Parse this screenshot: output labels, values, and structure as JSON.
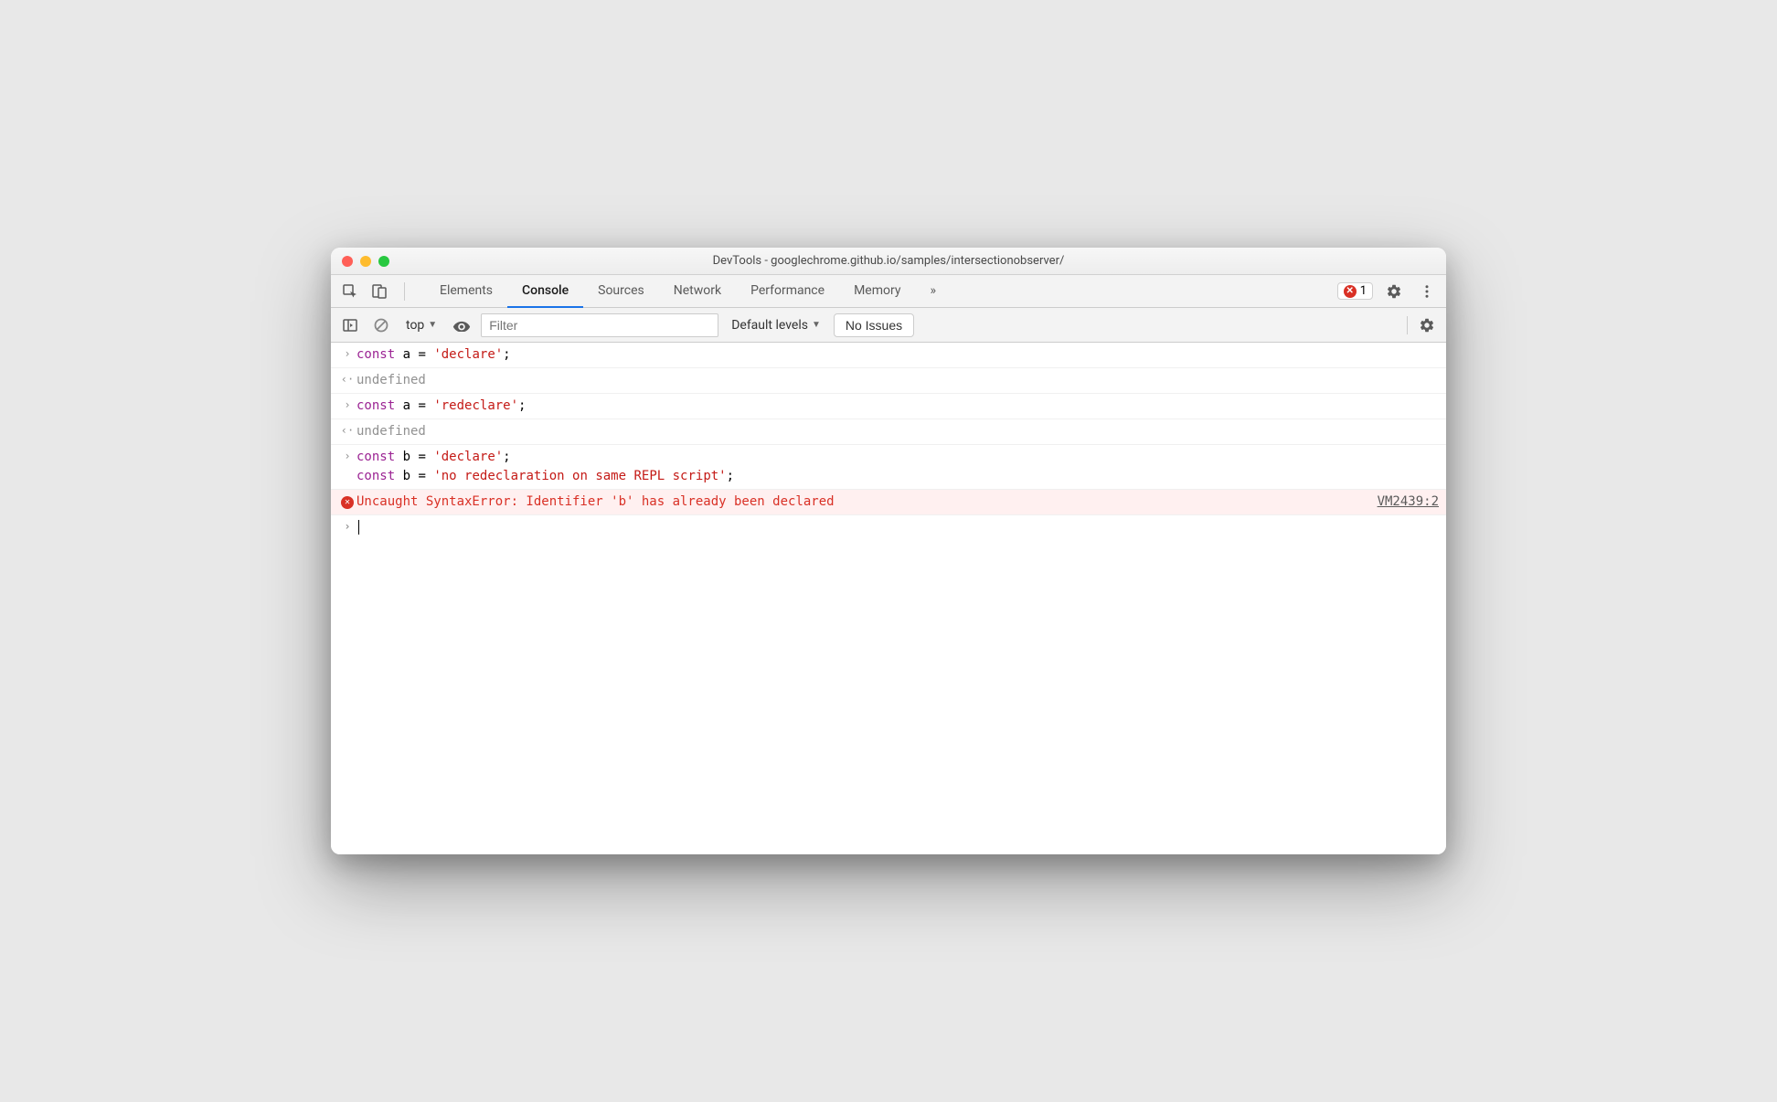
{
  "window": {
    "title": "DevTools - googlechrome.github.io/samples/intersectionobserver/"
  },
  "tabs": {
    "items": [
      "Elements",
      "Console",
      "Sources",
      "Network",
      "Performance",
      "Memory"
    ],
    "active_index": 1,
    "overflow_glyph": "»"
  },
  "error_badge": {
    "count": "1"
  },
  "toolbar": {
    "context": "top",
    "filter_placeholder": "Filter",
    "filter_value": "",
    "levels": "Default levels",
    "issues_button": "No Issues"
  },
  "console": {
    "rows": [
      {
        "type": "input",
        "gutter": "›",
        "code_html": "<span class='kw'>const</span> a = <span class='str'>'declare'</span>;"
      },
      {
        "type": "output",
        "gutter": "‹·",
        "code_html": "<span class='undef'>undefined</span>"
      },
      {
        "type": "input",
        "gutter": "›",
        "code_html": "<span class='kw'>const</span> a = <span class='str'>'redeclare'</span>;"
      },
      {
        "type": "output",
        "gutter": "‹·",
        "code_html": "<span class='undef'>undefined</span>"
      },
      {
        "type": "input",
        "gutter": "›",
        "code_html": "<span class='kw'>const</span> b = <span class='str'>'declare'</span>;\n<span class='kw'>const</span> b = <span class='str'>'no redeclaration on same REPL script'</span>;"
      },
      {
        "type": "error",
        "text": "Uncaught SyntaxError: Identifier 'b' has already been declared",
        "source": "VM2439:2"
      },
      {
        "type": "prompt",
        "gutter": "›"
      }
    ]
  }
}
